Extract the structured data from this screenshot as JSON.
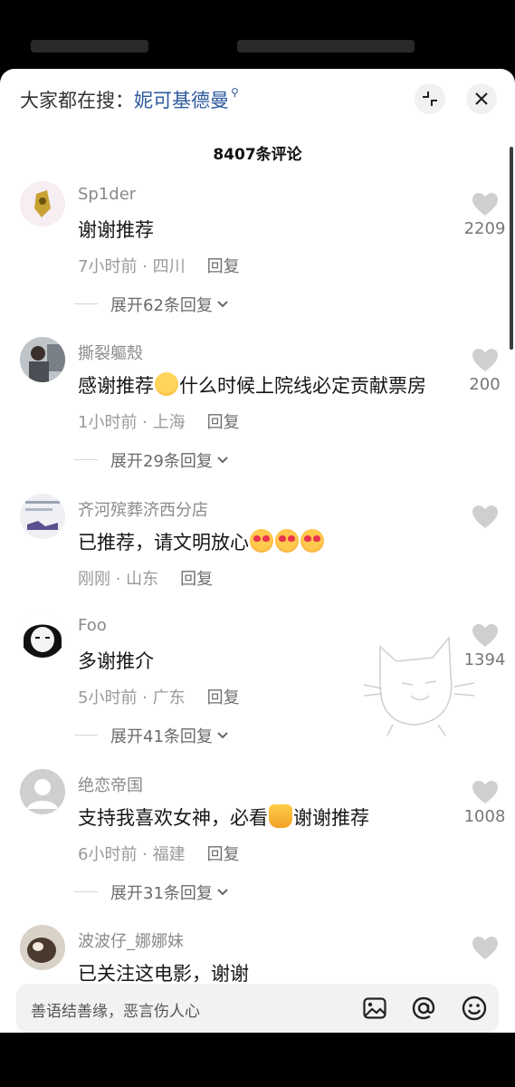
{
  "header": {
    "hot_search_prefix": "大家都在搜：",
    "hot_search_term": "妮可基德曼",
    "comment_count_label": "8407条评论"
  },
  "comments": [
    {
      "username": "Sp1der",
      "text": "谢谢推荐",
      "time": "7小时前 · 四川",
      "reply_label": "回复",
      "expand_label": "展开62条回复",
      "likes": "2209"
    },
    {
      "username": "撕裂軀殼",
      "text_before": "感谢推荐",
      "text_after": "什么时候上院线必定贡献票房",
      "time": "1小时前 · 上海",
      "reply_label": "回复",
      "expand_label": "展开29条回复",
      "likes": "200"
    },
    {
      "username": "齐河殡葬济西分店",
      "text": "已推荐，请文明放心",
      "time": "刚刚 · 山东",
      "reply_label": "回复"
    },
    {
      "username": "Foo",
      "text": "多谢推介",
      "time": "5小时前 · 广东",
      "reply_label": "回复",
      "expand_label": "展开41条回复",
      "likes": "1394"
    },
    {
      "username": "绝恋帝国",
      "text_before": "支持我喜欢女神，必看",
      "text_after": "谢谢推荐",
      "time": "6小时前 · 福建",
      "reply_label": "回复",
      "expand_label": "展开31条回复",
      "likes": "1008"
    },
    {
      "username": "波波仔_娜娜妹",
      "text": "已关注这电影，谢谢"
    }
  ],
  "input": {
    "placeholder": "善语结善缘，恶言伤人心"
  },
  "icons": {
    "search_hint": "search-icon",
    "collapse": "collapse-icon",
    "close": "close-icon",
    "like": "heart-icon",
    "image": "image-icon",
    "mention": "at-icon",
    "emoji": "smiley-icon"
  },
  "colors": {
    "link_blue": "#2f5b9f",
    "text": "#161616",
    "muted": "#9a9a9a",
    "heart": "#cfcfcf"
  }
}
